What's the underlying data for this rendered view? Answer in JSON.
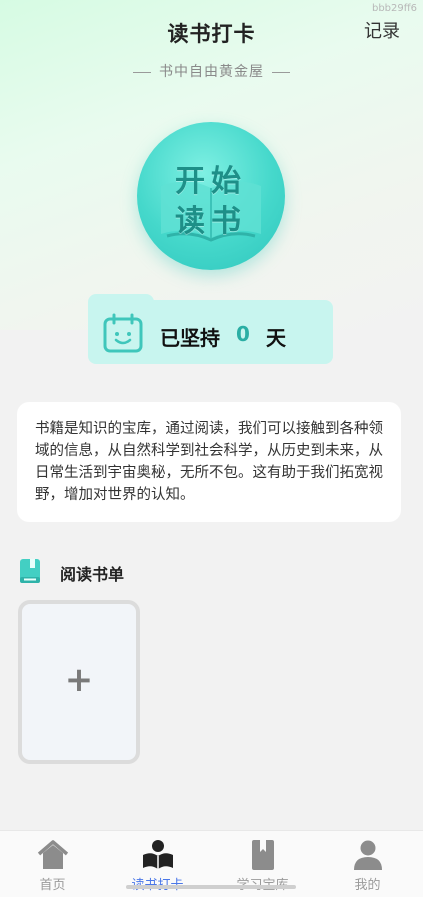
{
  "watermark": "bbb29ff6",
  "header": {
    "title": "读书打卡",
    "record_label": "记录",
    "subtitle": "书中自由黄金屋"
  },
  "start_button": {
    "line1": "开始",
    "line2": "读书"
  },
  "streak": {
    "label": "已坚持",
    "count": "0",
    "unit": "天"
  },
  "description": "书籍是知识的宝库，通过阅读，我们可以接触到各种领域的信息，从自然科学到社会科学，从历史到未来，从日常生活到宇宙奥秘，无所不包。这有助于我们拓宽视野，增加对世界的认知。",
  "reading_list": {
    "title": "阅读书单",
    "add_symbol": "+"
  },
  "tabbar": {
    "items": [
      {
        "label": "首页",
        "icon": "home-icon"
      },
      {
        "label": "读书打卡",
        "icon": "reading-icon",
        "active": true
      },
      {
        "label": "学习宝库",
        "icon": "book-icon"
      },
      {
        "label": "我的",
        "icon": "user-icon"
      }
    ]
  },
  "colors": {
    "accent": "#2aaea4",
    "active_tab": "#4a77e8",
    "streak_bg": "#c8f5ef"
  }
}
